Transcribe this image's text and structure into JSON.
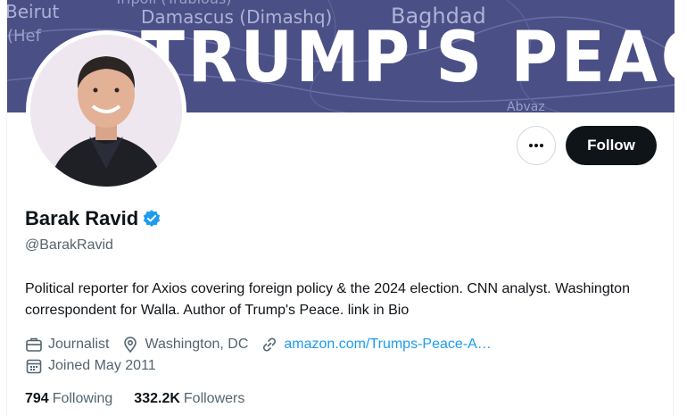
{
  "banner": {
    "title": "TRUMP'S PEACE",
    "map_labels": [
      "Beirut",
      "Damascus (Dimashq)",
      "Baghdad",
      "Tripoli (Trablous)",
      "(Hef",
      "Abvaz"
    ],
    "bg_color": "#4a4f86"
  },
  "profile": {
    "display_name": "Barak Ravid",
    "handle": "@BarakRavid",
    "verified": true,
    "bio": "Political reporter for Axios covering foreign policy & the 2024 election. CNN analyst. Washington correspondent for Walla. Author of Trump's Peace. link in Bio"
  },
  "actions": {
    "more_icon": "ellipsis-icon",
    "follow_label": "Follow"
  },
  "meta": {
    "category": "Journalist",
    "location": "Washington, DC",
    "website": "amazon.com/Trumps-Peace-A…",
    "joined": "Joined May 2011"
  },
  "stats": {
    "following_count": "794",
    "following_label": "Following",
    "followers_count": "332.2K",
    "followers_label": "Followers"
  },
  "colors": {
    "accent": "#1d9bf0",
    "text_primary": "#0f1419",
    "text_secondary": "#536471",
    "follow_bg": "#0f1419"
  }
}
